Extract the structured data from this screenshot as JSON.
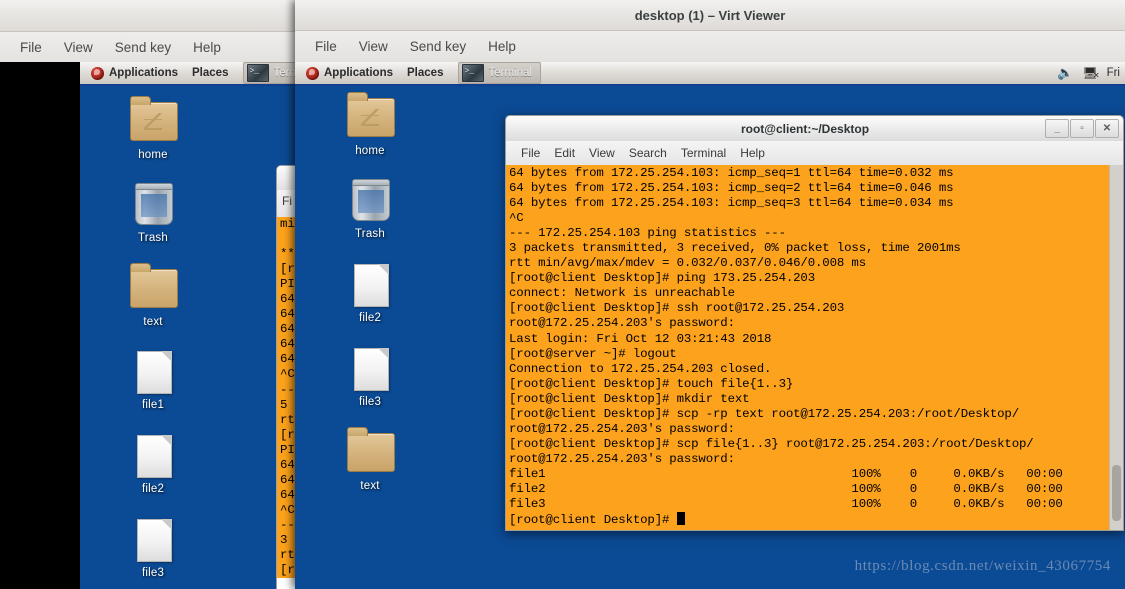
{
  "background_window": {
    "name": "virt-viewer-background-window",
    "menu": [
      "File",
      "View",
      "Send key",
      "Help"
    ],
    "panel": {
      "applications": "Applications",
      "places": "Places",
      "task": "Terminal"
    },
    "desktop_icons": [
      {
        "name": "home",
        "type": "home-folder"
      },
      {
        "name": "Trash",
        "type": "trash"
      },
      {
        "name": "text",
        "type": "folder"
      },
      {
        "name": "file1",
        "type": "file"
      },
      {
        "name": "file2",
        "type": "file"
      },
      {
        "name": "file3",
        "type": "file"
      }
    ],
    "terminal_edge_lines": [
      "mi",
      "",
      "**",
      "[r",
      "PI",
      "64",
      "64",
      "64",
      "64",
      "64",
      "^C",
      "--",
      "5",
      "rt",
      "[r",
      "PI",
      "64",
      "64",
      "64",
      "^C",
      "--",
      "3",
      "rt",
      "[r"
    ]
  },
  "main_window": {
    "title": "desktop (1) – Virt Viewer",
    "menu": [
      "File",
      "View",
      "Send key",
      "Help"
    ],
    "panel": {
      "applications": "Applications",
      "places": "Places",
      "task": "Terminal",
      "clock": "Fri",
      "tray_icons": [
        "volume-icon",
        "network-disconnected-icon"
      ]
    },
    "desktop_icons": [
      {
        "name": "home",
        "type": "home-folder"
      },
      {
        "name": "Trash",
        "type": "trash"
      },
      {
        "name": "file2",
        "type": "file"
      },
      {
        "name": "file3",
        "type": "file"
      },
      {
        "name": "text",
        "type": "folder"
      }
    ]
  },
  "terminal": {
    "title": "root@client:~/Desktop",
    "menu": [
      "File",
      "Edit",
      "View",
      "Search",
      "Terminal",
      "Help"
    ],
    "window_buttons": [
      {
        "name": "minimize",
        "glyph": "_"
      },
      {
        "name": "maximize",
        "glyph": "▫"
      },
      {
        "name": "close",
        "glyph": "✕"
      }
    ],
    "background_color": "#fca21c",
    "foreground_color": "#000000",
    "lines": [
      "64 bytes from 172.25.254.103: icmp_seq=1 ttl=64 time=0.032 ms",
      "64 bytes from 172.25.254.103: icmp_seq=2 ttl=64 time=0.046 ms",
      "64 bytes from 172.25.254.103: icmp_seq=3 ttl=64 time=0.034 ms",
      "^C",
      "--- 172.25.254.103 ping statistics ---",
      "3 packets transmitted, 3 received, 0% packet loss, time 2001ms",
      "rtt min/avg/max/mdev = 0.032/0.037/0.046/0.008 ms",
      "[root@client Desktop]# ping 173.25.254.203",
      "connect: Network is unreachable",
      "[root@client Desktop]# ssh root@172.25.254.203",
      "root@172.25.254.203's password:",
      "Last login: Fri Oct 12 03:21:43 2018",
      "[root@server ~]# logout",
      "Connection to 172.25.254.203 closed.",
      "[root@client Desktop]# touch file{1..3}",
      "[root@client Desktop]# mkdir text",
      "[root@client Desktop]# scp -rp text root@172.25.254.203:/root/Desktop/",
      "root@172.25.254.203's password:",
      "[root@client Desktop]# scp file{1..3} root@172.25.254.203:/root/Desktop/",
      "root@172.25.254.203's password:",
      "file1                                          100%    0     0.0KB/s   00:00",
      "file2                                          100%    0     0.0KB/s   00:00",
      "file3                                          100%    0     0.0KB/s   00:00"
    ],
    "prompt": "[root@client Desktop]# "
  },
  "watermark": "https://blog.csdn.net/weixin_43067754"
}
